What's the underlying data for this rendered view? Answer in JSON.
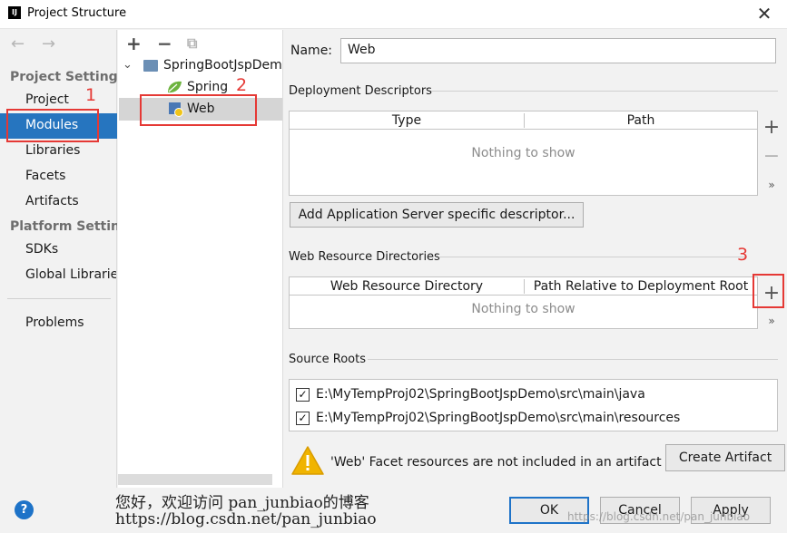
{
  "window": {
    "app_icon": "IJ",
    "title": "Project Structure",
    "close": "✕"
  },
  "left_nav": {
    "back": "←",
    "forward": "→",
    "project_settings_heading": "Project Settings",
    "project_settings_items": [
      "Project",
      "Modules",
      "Libraries",
      "Facets",
      "Artifacts"
    ],
    "platform_settings_heading": "Platform Settings",
    "platform_settings_items": [
      "SDKs",
      "Global Libraries"
    ],
    "problems": "Problems",
    "selected": "Modules"
  },
  "tree": {
    "toolbar": {
      "add": "+",
      "remove": "−",
      "copy": "⧉"
    },
    "root": "SpringBootJspDemo",
    "expander": "⌄",
    "children": [
      "Spring",
      "Web"
    ],
    "selected": "Web"
  },
  "annotations": {
    "n1": "1",
    "n2": "2",
    "n3": "3"
  },
  "form": {
    "name_label": "Name:",
    "name_value": "Web",
    "deployment_descriptors": {
      "heading": "Deployment Descriptors",
      "columns": [
        "Type",
        "Path"
      ],
      "empty": "Nothing to show",
      "add_button": "Add Application Server specific descriptor..."
    },
    "web_resource_directories": {
      "heading": "Web Resource Directories",
      "columns": [
        "Web Resource Directory",
        "Path Relative to Deployment Root"
      ],
      "empty": "Nothing to show"
    },
    "source_roots": {
      "heading": "Source Roots",
      "items": [
        {
          "checked": true,
          "path": "E:\\MyTempProj02\\SpringBootJspDemo\\src\\main\\java"
        },
        {
          "checked": true,
          "path": "E:\\MyTempProj02\\SpringBootJspDemo\\src\\main\\resources"
        }
      ]
    },
    "warning": {
      "icon": "!",
      "text": "'Web' Facet resources are not included in an artifact",
      "button": "Create Artifact"
    },
    "side_tools": {
      "add": "+",
      "remove": "−",
      "more": "»"
    }
  },
  "footer": {
    "help": "?",
    "ok": "OK",
    "cancel": "Cancel",
    "apply": "Apply",
    "watermark_line1": "您好，欢迎访问 pan_junbiao的博客",
    "watermark_line2": "https://blog.csdn.net/pan_junbiao",
    "watermark_line3": "https://blog.csdn.net/pan_junbiao"
  },
  "colors": {
    "selection": "#2675bf",
    "annotation_red": "#e53935",
    "warning_yellow": "#f0b400",
    "spring_green": "#6db33f",
    "help_blue": "#1e73c8"
  }
}
